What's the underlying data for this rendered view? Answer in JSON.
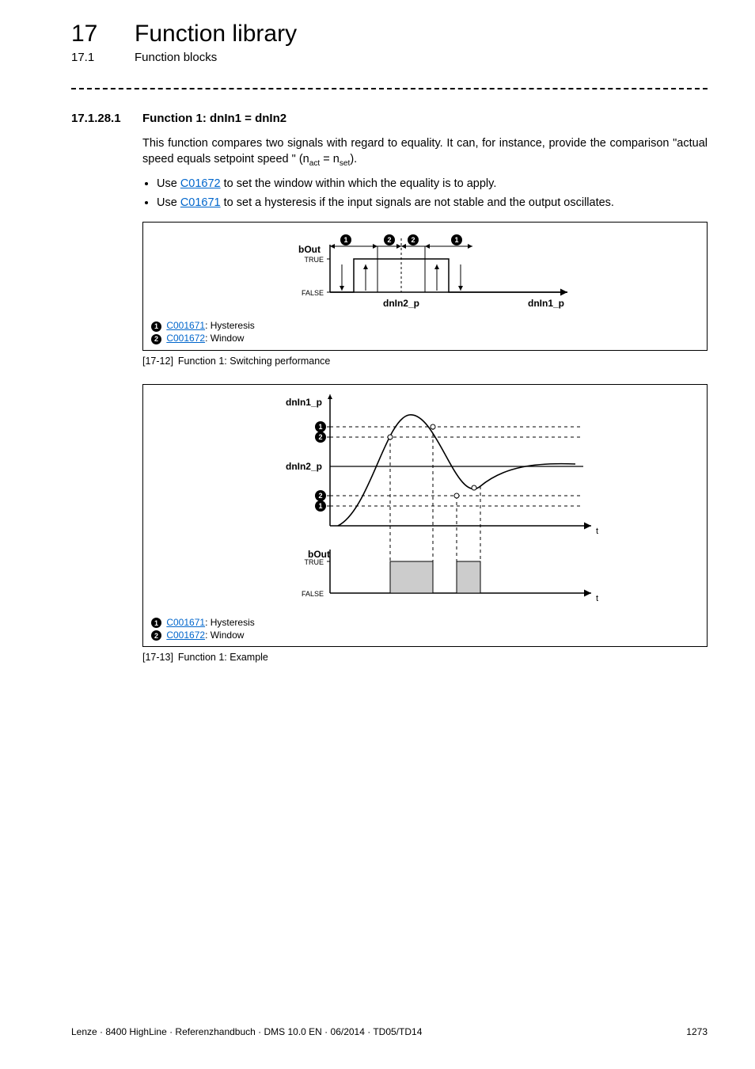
{
  "header": {
    "chapter_number": "17",
    "chapter_title": "Function library",
    "section_number": "17.1",
    "section_title": "Function blocks"
  },
  "subsection": {
    "number": "17.1.28.1",
    "title": "Function 1: dnIn1 = dnIn2"
  },
  "body": {
    "para1_a": "This function compares two signals with regard to equality. It can, for instance, provide the comparison \"actual speed equals setpoint speed \" (n",
    "para1_sub1": "act",
    "para1_b": " = n",
    "para1_sub2": "set",
    "para1_c": ").",
    "bullet1_a": "Use ",
    "bullet1_link": "C01672",
    "bullet1_b": " to set the window within which the equality is to apply.",
    "bullet2_a": "Use ",
    "bullet2_link": "C01671",
    "bullet2_b": " to set a hysteresis if the input signals are not stable and the output oscillates."
  },
  "fig1": {
    "legend1_link": "C001671",
    "legend1_text": ": Hysteresis",
    "legend2_link": "C001672",
    "legend2_text": ": Window",
    "caption_tag": "[17-12]",
    "caption_text": "Function 1: Switching performance"
  },
  "fig2": {
    "legend1_link": "C001671",
    "legend1_text": ": Hysteresis",
    "legend2_link": "C001672",
    "legend2_text": ": Window",
    "caption_tag": "[17-13]",
    "caption_text": "Function 1: Example"
  },
  "chart_data": [
    {
      "type": "diagram",
      "title": "Function 1: Switching performance",
      "output": {
        "name": "bOut",
        "levels": [
          "TRUE",
          "FALSE"
        ]
      },
      "x_axes": [
        "dnIn2_p",
        "dnIn1_p"
      ],
      "bands": [
        {
          "marker": "1",
          "param": "C001671",
          "meaning": "Hysteresis"
        },
        {
          "marker": "2",
          "param": "C001672",
          "meaning": "Window"
        }
      ]
    },
    {
      "type": "diagram",
      "title": "Function 1: Example",
      "top_plot": {
        "signals": [
          "dnIn1_p",
          "dnIn2_p"
        ],
        "x_axis": "t",
        "bands": [
          {
            "marker": "1",
            "param": "C001671",
            "meaning": "Hysteresis"
          },
          {
            "marker": "2",
            "param": "C001672",
            "meaning": "Window"
          }
        ]
      },
      "bottom_plot": {
        "output": "bOut",
        "levels": [
          "TRUE",
          "FALSE"
        ],
        "x_axis": "t"
      }
    }
  ],
  "footer": {
    "left": "Lenze · 8400 HighLine · Referenzhandbuch · DMS 10.0 EN · 06/2014 · TD05/TD14",
    "right": "1273"
  }
}
